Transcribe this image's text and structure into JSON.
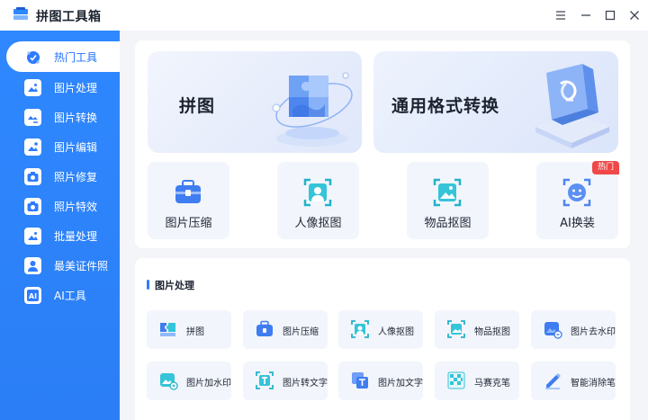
{
  "app": {
    "title": "拼图工具箱"
  },
  "sidebar": {
    "items": [
      {
        "label": "热门工具",
        "icon": "fire-tools-icon",
        "active": true
      },
      {
        "label": "图片处理",
        "icon": "image-process-icon"
      },
      {
        "label": "图片转换",
        "icon": "image-convert-icon"
      },
      {
        "label": "图片编辑",
        "icon": "image-edit-icon"
      },
      {
        "label": "照片修复",
        "icon": "photo-repair-icon"
      },
      {
        "label": "照片特效",
        "icon": "photo-effects-icon"
      },
      {
        "label": "批量处理",
        "icon": "batch-process-icon"
      },
      {
        "label": "最美证件照",
        "icon": "id-photo-icon"
      },
      {
        "label": "AI工具",
        "icon": "ai-tools-icon"
      }
    ]
  },
  "banners": [
    {
      "label": "拼图",
      "icon": "puzzle-illustration"
    },
    {
      "label": "通用格式转换",
      "icon": "format-convert-illustration"
    }
  ],
  "hot_tools": [
    {
      "label": "图片压缩",
      "icon": "compress-icon"
    },
    {
      "label": "人像抠图",
      "icon": "portrait-cutout-icon"
    },
    {
      "label": "物品抠图",
      "icon": "object-cutout-icon"
    },
    {
      "label": "AI换装",
      "icon": "ai-outfit-icon",
      "badge": "热门"
    }
  ],
  "image_section": {
    "title": "图片处理",
    "tools": [
      {
        "label": "拼图",
        "icon": "puzzle-icon"
      },
      {
        "label": "图片压缩",
        "icon": "compress-icon"
      },
      {
        "label": "人像抠图",
        "icon": "portrait-cutout-icon"
      },
      {
        "label": "物品抠图",
        "icon": "object-cutout-icon"
      },
      {
        "label": "图片去水印",
        "icon": "remove-watermark-icon"
      },
      {
        "label": "图片加水印",
        "icon": "add-watermark-icon"
      },
      {
        "label": "图片转文字",
        "icon": "image-to-text-icon"
      },
      {
        "label": "图片加文字",
        "icon": "add-text-icon"
      },
      {
        "label": "马赛克笔",
        "icon": "mosaic-icon"
      },
      {
        "label": "智能消除笔",
        "icon": "smart-eraser-icon"
      }
    ]
  },
  "colors": {
    "accent": "#2f88ff",
    "hot": "#f04848"
  }
}
